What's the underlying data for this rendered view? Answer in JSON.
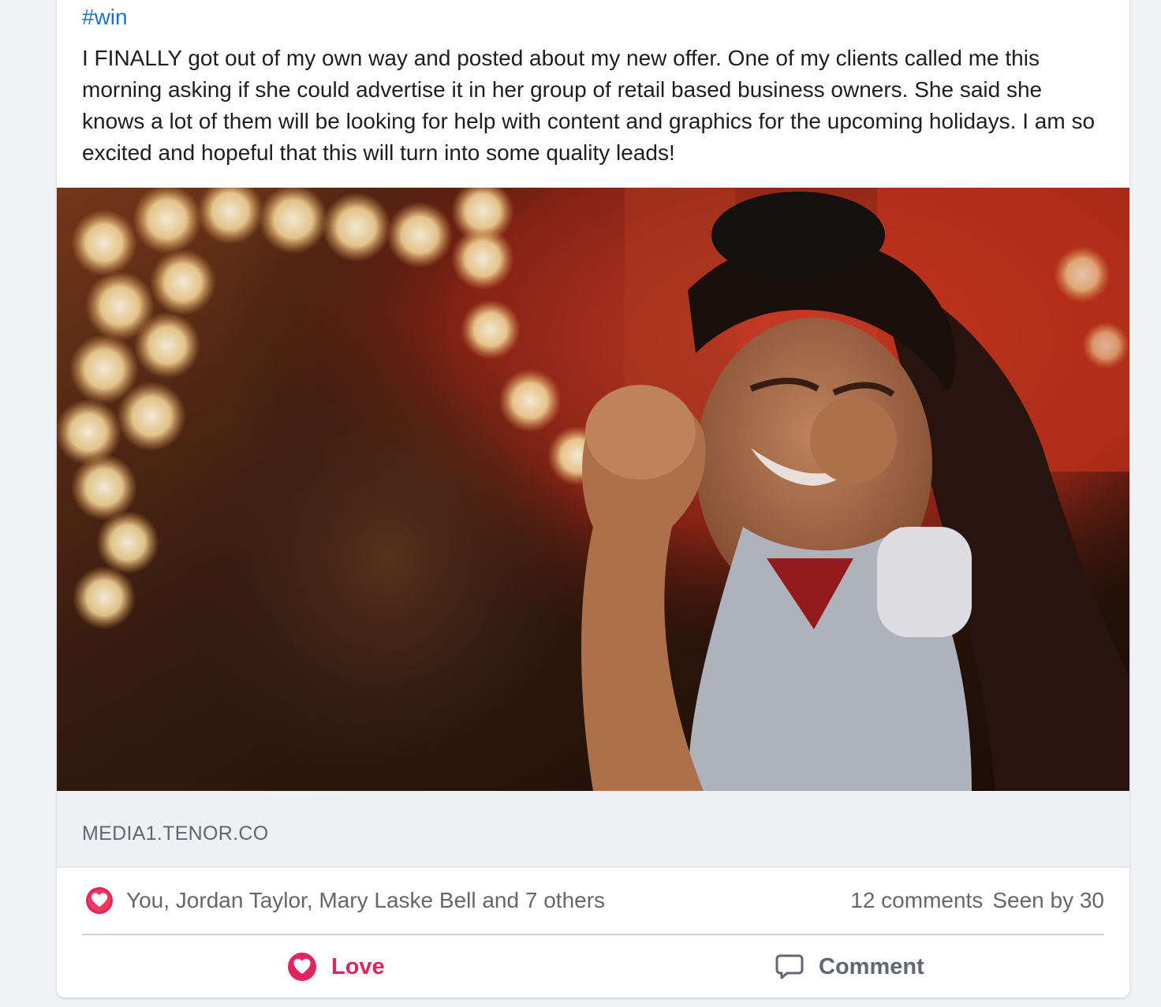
{
  "post": {
    "hashtag": "#win",
    "body": "I FINALLY got out of my own way and posted about my new offer. One of my clients called me this morning asking if she could advertise it in her group of retail based business owners. She said she knows a lot of them will be looking for help with content and graphics for the upcoming holidays. I am so excited and hopeful that this will turn into some quality leads!",
    "media": {
      "domain": "MEDIA1.TENOR.CO"
    }
  },
  "reactions": {
    "icon": "heart-icon",
    "reactors": "You, Jordan Taylor, Mary Laske Bell and 7 others",
    "comments_count": "12 comments",
    "seen_by": "Seen by 30"
  },
  "actions": {
    "love_label": "Love",
    "love_icon": "heart-icon",
    "comment_label": "Comment",
    "comment_icon": "speech-bubble-icon"
  },
  "colors": {
    "hashtag": "#1f72c9",
    "love": "#e0245e",
    "muted_text": "#65676b"
  }
}
